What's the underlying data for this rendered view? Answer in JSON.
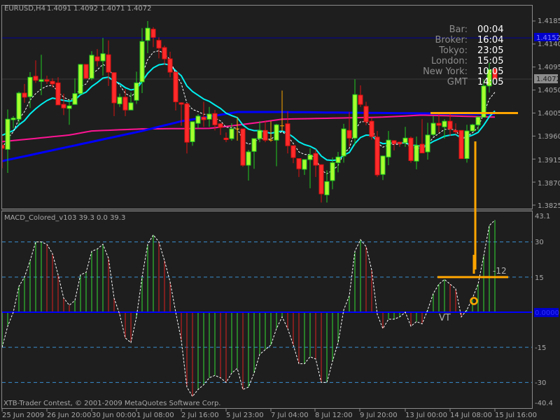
{
  "header": {
    "symbol": "EURUSD,H4",
    "ohlc": "1.4091 1.4092 1.4071 1.4072"
  },
  "clock": [
    {
      "label": "Bar:",
      "value": "00:04"
    },
    {
      "label": "Broker:",
      "value": "16:04"
    },
    {
      "label": "Tokyo:",
      "value": "23:05"
    },
    {
      "label": "London:",
      "value": "15:05"
    },
    {
      "label": "New York:",
      "value": "10:05"
    },
    {
      "label": "GMT",
      "value": "14:05"
    }
  ],
  "price_axis": {
    "ticks": [
      "1.4185",
      "1.4140",
      "1.4095",
      "1.4050",
      "1.4005",
      "1.3960",
      "1.3915",
      "1.3870",
      "1.3825"
    ],
    "current_price_label": "1.4072",
    "line_price_label": "1.4152"
  },
  "indicator": {
    "title": "MACD_Colored_v103 39.3 0.0 39.3",
    "axis_labels": {
      "max": "43.1",
      "l30": "30",
      "l15": "15",
      "zero": "0.0000",
      "lm15": "-15",
      "lm30": "-30",
      "min": "-40.4"
    },
    "annotation_vt": "VT",
    "annotation_12": "-12"
  },
  "copyright": "XTB-Trader Contest, © 2001-2009 MetaQuotes Software Corp.",
  "time_axis": [
    "25 Jun 2009",
    "26 Jun 20:00",
    "30 Jun 00:00",
    "1 Jul 08:00",
    "2 Jul 16:00",
    "5 Jul 23:00",
    "7 Jul 04:00",
    "8 Jul 12:00",
    "9 Jul 20:00",
    "13 Jul 00:00",
    "14 Jul 08:00",
    "15 Jul 16:00"
  ],
  "colors": {
    "bull_fill": "#a6ff2e",
    "bull_edge": "#22cc22",
    "bear_fill": "#ff2b2b",
    "bear_edge": "#dd1111",
    "doji": "#ffa500",
    "cyan_ma": "#00f0f0",
    "blue_ma": "#0000ff",
    "pink_ma": "#ff1493",
    "annotation": "#ffa500"
  },
  "chart_data": {
    "type": "candlestick",
    "price_range": [
      1.3825,
      1.4185
    ],
    "candles_ohlc": [
      [
        1.3942,
        1.3962,
        1.3897,
        1.3936
      ],
      [
        1.3934,
        1.4012,
        1.3888,
        1.3993
      ],
      [
        1.3992,
        1.3999,
        1.3975,
        1.3995
      ],
      [
        1.3993,
        1.4047,
        1.3982,
        1.4044
      ],
      [
        1.4044,
        1.4062,
        1.4025,
        1.4036
      ],
      [
        1.4037,
        1.4085,
        1.4015,
        1.4075
      ],
      [
        1.4077,
        1.4108,
        1.4064,
        1.4069
      ],
      [
        1.4067,
        1.4119,
        1.404,
        1.407
      ],
      [
        1.407,
        1.4078,
        1.4062,
        1.4069
      ],
      [
        1.4067,
        1.4073,
        1.4055,
        1.4062
      ],
      [
        1.4064,
        1.4075,
        1.4021,
        1.4021
      ],
      [
        1.4022,
        1.4043,
        1.4001,
        1.4015
      ],
      [
        1.4014,
        1.4032,
        1.3982,
        1.4019
      ],
      [
        1.4022,
        1.4073,
        1.4021,
        1.4043
      ],
      [
        1.4043,
        1.4101,
        1.4041,
        1.41
      ],
      [
        1.41,
        1.41,
        1.4073,
        1.4073
      ],
      [
        1.4073,
        1.4126,
        1.4069,
        1.4118
      ],
      [
        1.4115,
        1.413,
        1.4096,
        1.4107
      ],
      [
        1.4107,
        1.4152,
        1.4078,
        1.4121
      ],
      [
        1.4119,
        1.4147,
        1.4058,
        1.4085
      ],
      [
        1.4084,
        1.4084,
        1.3999,
        1.4025
      ],
      [
        1.4023,
        1.4043,
        1.4017,
        1.4036
      ],
      [
        1.4036,
        1.4052,
        1.3999,
        1.4011
      ],
      [
        1.4011,
        1.4045,
        1.4011,
        1.4025
      ],
      [
        1.403,
        1.4086,
        1.4023,
        1.4064
      ],
      [
        1.4066,
        1.4171,
        1.4044,
        1.4145
      ],
      [
        1.4147,
        1.4185,
        1.4122,
        1.4171
      ],
      [
        1.4169,
        1.4173,
        1.4134,
        1.4153
      ],
      [
        1.4147,
        1.4153,
        1.4112,
        1.4132
      ],
      [
        1.4133,
        1.4137,
        1.4099,
        1.4111
      ],
      [
        1.4111,
        1.4125,
        1.4075,
        1.4085
      ],
      [
        1.4085,
        1.4085,
        1.401,
        1.4027
      ],
      [
        1.4025,
        1.4026,
        1.398,
        1.4024
      ],
      [
        1.4023,
        1.4025,
        1.3926,
        1.3948
      ],
      [
        1.3949,
        1.3988,
        1.3941,
        1.3988
      ],
      [
        1.3985,
        1.4003,
        1.3975,
        1.3999
      ],
      [
        1.3997,
        1.4027,
        1.3978,
        1.3992
      ],
      [
        1.3993,
        1.4017,
        1.3978,
        1.4003
      ],
      [
        1.4004,
        1.4011,
        1.3971,
        1.3982
      ],
      [
        1.3984,
        1.3985,
        1.3962,
        1.3977
      ],
      [
        1.3956,
        1.3967,
        1.3948,
        1.3953
      ],
      [
        1.3955,
        1.3985,
        1.3951,
        1.3974
      ],
      [
        1.3974,
        1.3997,
        1.3951,
        1.3974
      ],
      [
        1.3974,
        1.3974,
        1.39,
        1.3903
      ],
      [
        1.3903,
        1.3933,
        1.3873,
        1.3929
      ],
      [
        1.393,
        1.3955,
        1.3896,
        1.3955
      ],
      [
        1.3955,
        1.3989,
        1.3948,
        1.3971
      ],
      [
        1.3971,
        1.3989,
        1.3948,
        1.3952
      ],
      [
        1.3952,
        1.3989,
        1.3949,
        1.3952
      ],
      [
        1.3952,
        1.3984,
        1.3901,
        1.3982
      ],
      [
        1.398,
        1.4049,
        1.397,
        1.398
      ],
      [
        1.3984,
        1.4008,
        1.3926,
        1.3941
      ],
      [
        1.3941,
        1.3942,
        1.3907,
        1.3918
      ],
      [
        1.3916,
        1.3916,
        1.388,
        1.3896
      ],
      [
        1.3895,
        1.3914,
        1.3884,
        1.3914
      ],
      [
        1.3914,
        1.3936,
        1.3858,
        1.3923
      ],
      [
        1.3926,
        1.3934,
        1.388,
        1.3903
      ],
      [
        1.3904,
        1.3904,
        1.383,
        1.3847
      ],
      [
        1.3845,
        1.3893,
        1.383,
        1.3871
      ],
      [
        1.3873,
        1.3918,
        1.3856,
        1.3908
      ],
      [
        1.3908,
        1.3929,
        1.3889,
        1.3919
      ],
      [
        1.3921,
        1.3984,
        1.3908,
        1.3974
      ],
      [
        1.3971,
        1.4007,
        1.3939,
        1.3956
      ],
      [
        1.3956,
        1.4071,
        1.3942,
        1.4041
      ],
      [
        1.404,
        1.4059,
        1.4017,
        1.4022
      ],
      [
        1.4018,
        1.4027,
        1.3981,
        1.3988
      ],
      [
        1.3989,
        1.3996,
        1.3953,
        1.3959
      ],
      [
        1.3958,
        1.397,
        1.388,
        1.3884
      ],
      [
        1.3885,
        1.3922,
        1.3874,
        1.3921
      ],
      [
        1.3919,
        1.397,
        1.3903,
        1.3952
      ],
      [
        1.3951,
        1.3952,
        1.3932,
        1.3945
      ],
      [
        1.3948,
        1.3949,
        1.3939,
        1.3945
      ],
      [
        1.3947,
        1.3978,
        1.3939,
        1.3956
      ],
      [
        1.3956,
        1.3959,
        1.3908,
        1.3912
      ],
      [
        1.3911,
        1.3959,
        1.3895,
        1.3942
      ],
      [
        1.3944,
        1.3993,
        1.3927,
        1.3927
      ],
      [
        1.3929,
        1.3986,
        1.3914,
        1.3962
      ],
      [
        1.3963,
        1.3999,
        1.396,
        1.3985
      ],
      [
        1.3985,
        1.4003,
        1.3967,
        1.3981
      ],
      [
        1.3978,
        1.3993,
        1.3955,
        1.3989
      ],
      [
        1.3989,
        1.4007,
        1.396,
        1.3974
      ],
      [
        1.3971,
        1.3985,
        1.3963,
        1.397
      ],
      [
        1.3971,
        1.3971,
        1.3915,
        1.3916
      ],
      [
        1.3916,
        1.3982,
        1.3908,
        1.397
      ],
      [
        1.397,
        1.3984,
        1.397,
        1.3982
      ],
      [
        1.3982,
        1.3999,
        1.3971,
        1.3997
      ],
      [
        1.3997,
        1.4071,
        1.3996,
        1.4058
      ],
      [
        1.4058,
        1.4103,
        1.4045,
        1.409
      ],
      [
        1.4091,
        1.4092,
        1.4071,
        1.4072
      ]
    ],
    "blue_ma_points": [
      [
        0,
        1.3911
      ],
      [
        25,
        1.397
      ],
      [
        32,
        1.3989
      ],
      [
        42,
        1.4007
      ],
      [
        50,
        1.4007
      ],
      [
        88,
        1.4003
      ]
    ],
    "pink_ma_points": [
      [
        0,
        1.3949
      ],
      [
        12,
        1.3962
      ],
      [
        16,
        1.397
      ],
      [
        25,
        1.3974
      ],
      [
        37,
        1.3975
      ],
      [
        44,
        1.3984
      ],
      [
        50,
        1.3993
      ],
      [
        68,
        1.3997
      ],
      [
        75,
        1.4001
      ],
      [
        88,
        1.3997
      ]
    ],
    "cyan_ma_seed": 1.3966,
    "horizontal_line_price": 1.4152,
    "annotation_level_price": 1.4005,
    "macd_range": [
      -40.4,
      43.1
    ],
    "macd_levels": [
      30,
      15,
      -15,
      -30
    ],
    "macd_values": [
      -15,
      -6,
      0,
      11,
      15,
      22,
      30,
      30,
      29,
      25,
      16,
      6,
      3,
      5,
      16,
      17,
      26,
      27,
      29,
      23,
      6,
      -1,
      -11,
      -13,
      -2,
      15,
      29,
      33,
      30,
      22,
      13,
      0,
      -12,
      -32,
      -36,
      -33,
      -31,
      -28,
      -27,
      -28,
      -30,
      -26,
      -24,
      -33,
      -32,
      -26,
      -18,
      -16,
      -14,
      -7,
      -2,
      -7,
      -14,
      -22,
      -22,
      -19,
      -20,
      -30,
      -30,
      -21,
      -13,
      1,
      7,
      26,
      31,
      28,
      18,
      -1,
      -7,
      -3,
      -3,
      -2,
      0,
      -6,
      -4,
      -5,
      1,
      8,
      12,
      14,
      12,
      10,
      -2,
      1,
      6,
      12,
      24,
      37,
      39.3
    ],
    "macd_annotation_level": 15
  }
}
